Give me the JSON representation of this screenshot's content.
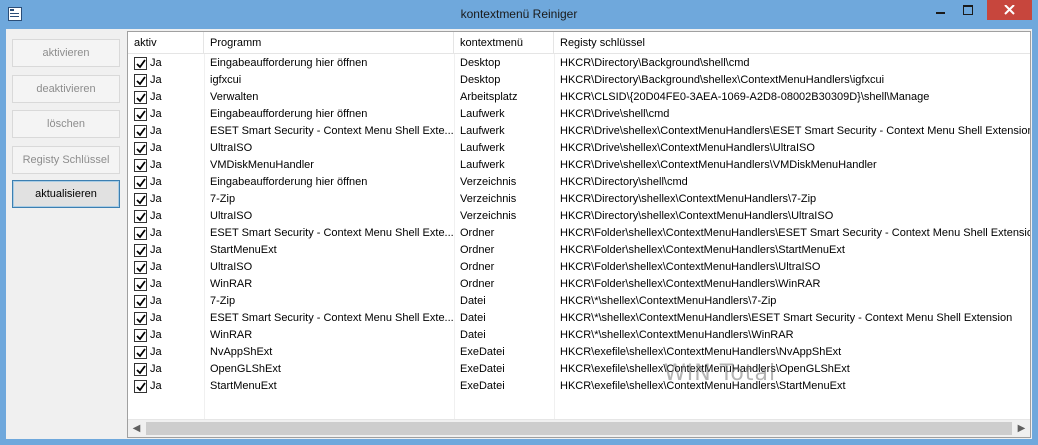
{
  "window": {
    "title": "kontextmenü Reiniger"
  },
  "sidebar": {
    "buttons": [
      {
        "label": "aktivieren"
      },
      {
        "label": "deaktivieren"
      },
      {
        "label": "löschen"
      },
      {
        "label": "Registy Schlüssel"
      },
      {
        "label": "aktualisieren"
      }
    ]
  },
  "table": {
    "columns": [
      "aktiv",
      "Programm",
      "kontextmenü",
      "Registy schlüssel"
    ],
    "rows": [
      {
        "aktiv": "Ja",
        "programm": "Eingabeaufforderung hier öffnen",
        "kontext": "Desktop",
        "key": "HKCR\\Directory\\Background\\shell\\cmd"
      },
      {
        "aktiv": "Ja",
        "programm": "igfxcui",
        "kontext": "Desktop",
        "key": "HKCR\\Directory\\Background\\shellex\\ContextMenuHandlers\\igfxcui"
      },
      {
        "aktiv": "Ja",
        "programm": "Verwalten",
        "kontext": "Arbeitsplatz",
        "key": "HKCR\\CLSID\\{20D04FE0-3AEA-1069-A2D8-08002B30309D}\\shell\\Manage"
      },
      {
        "aktiv": "Ja",
        "programm": "Eingabeaufforderung hier öffnen",
        "kontext": "Laufwerk",
        "key": "HKCR\\Drive\\shell\\cmd"
      },
      {
        "aktiv": "Ja",
        "programm": "ESET Smart Security - Context Menu Shell Exte...",
        "kontext": "Laufwerk",
        "key": "HKCR\\Drive\\shellex\\ContextMenuHandlers\\ESET Smart Security - Context Menu Shell Extension"
      },
      {
        "aktiv": "Ja",
        "programm": "UltraISO",
        "kontext": "Laufwerk",
        "key": "HKCR\\Drive\\shellex\\ContextMenuHandlers\\UltraISO"
      },
      {
        "aktiv": "Ja",
        "programm": "VMDiskMenuHandler",
        "kontext": "Laufwerk",
        "key": "HKCR\\Drive\\shellex\\ContextMenuHandlers\\VMDiskMenuHandler"
      },
      {
        "aktiv": "Ja",
        "programm": "Eingabeaufforderung hier öffnen",
        "kontext": "Verzeichnis",
        "key": "HKCR\\Directory\\shell\\cmd"
      },
      {
        "aktiv": "Ja",
        "programm": "7-Zip",
        "kontext": "Verzeichnis",
        "key": "HKCR\\Directory\\shellex\\ContextMenuHandlers\\7-Zip"
      },
      {
        "aktiv": "Ja",
        "programm": "UltraISO",
        "kontext": "Verzeichnis",
        "key": "HKCR\\Directory\\shellex\\ContextMenuHandlers\\UltraISO"
      },
      {
        "aktiv": "Ja",
        "programm": "ESET Smart Security - Context Menu Shell Exte...",
        "kontext": "Ordner",
        "key": "HKCR\\Folder\\shellex\\ContextMenuHandlers\\ESET Smart Security - Context Menu Shell Extension"
      },
      {
        "aktiv": "Ja",
        "programm": "StartMenuExt",
        "kontext": "Ordner",
        "key": "HKCR\\Folder\\shellex\\ContextMenuHandlers\\StartMenuExt"
      },
      {
        "aktiv": "Ja",
        "programm": "UltraISO",
        "kontext": "Ordner",
        "key": "HKCR\\Folder\\shellex\\ContextMenuHandlers\\UltraISO"
      },
      {
        "aktiv": "Ja",
        "programm": "WinRAR",
        "kontext": "Ordner",
        "key": "HKCR\\Folder\\shellex\\ContextMenuHandlers\\WinRAR"
      },
      {
        "aktiv": "Ja",
        "programm": "7-Zip",
        "kontext": "Datei",
        "key": "HKCR\\*\\shellex\\ContextMenuHandlers\\7-Zip"
      },
      {
        "aktiv": "Ja",
        "programm": "ESET Smart Security - Context Menu Shell Exte...",
        "kontext": "Datei",
        "key": "HKCR\\*\\shellex\\ContextMenuHandlers\\ESET Smart Security - Context Menu Shell Extension"
      },
      {
        "aktiv": "Ja",
        "programm": "WinRAR",
        "kontext": "Datei",
        "key": "HKCR\\*\\shellex\\ContextMenuHandlers\\WinRAR"
      },
      {
        "aktiv": "Ja",
        "programm": "NvAppShExt",
        "kontext": "ExeDatei",
        "key": "HKCR\\exefile\\shellex\\ContextMenuHandlers\\NvAppShExt"
      },
      {
        "aktiv": "Ja",
        "programm": "OpenGLShExt",
        "kontext": "ExeDatei",
        "key": "HKCR\\exefile\\shellex\\ContextMenuHandlers\\OpenGLShExt"
      },
      {
        "aktiv": "Ja",
        "programm": "StartMenuExt",
        "kontext": "ExeDatei",
        "key": "HKCR\\exefile\\shellex\\ContextMenuHandlers\\StartMenuExt"
      }
    ]
  },
  "scrollbar": {
    "left_icon": "scroll-left-arrow-icon",
    "right_icon": "scroll-right-arrow-icon"
  },
  "watermark": {
    "text": "WIN Total"
  },
  "colors": {
    "titlebar": "#6fa8dc",
    "close_button": "#c7463d",
    "focus_border": "#3c7fb1"
  }
}
